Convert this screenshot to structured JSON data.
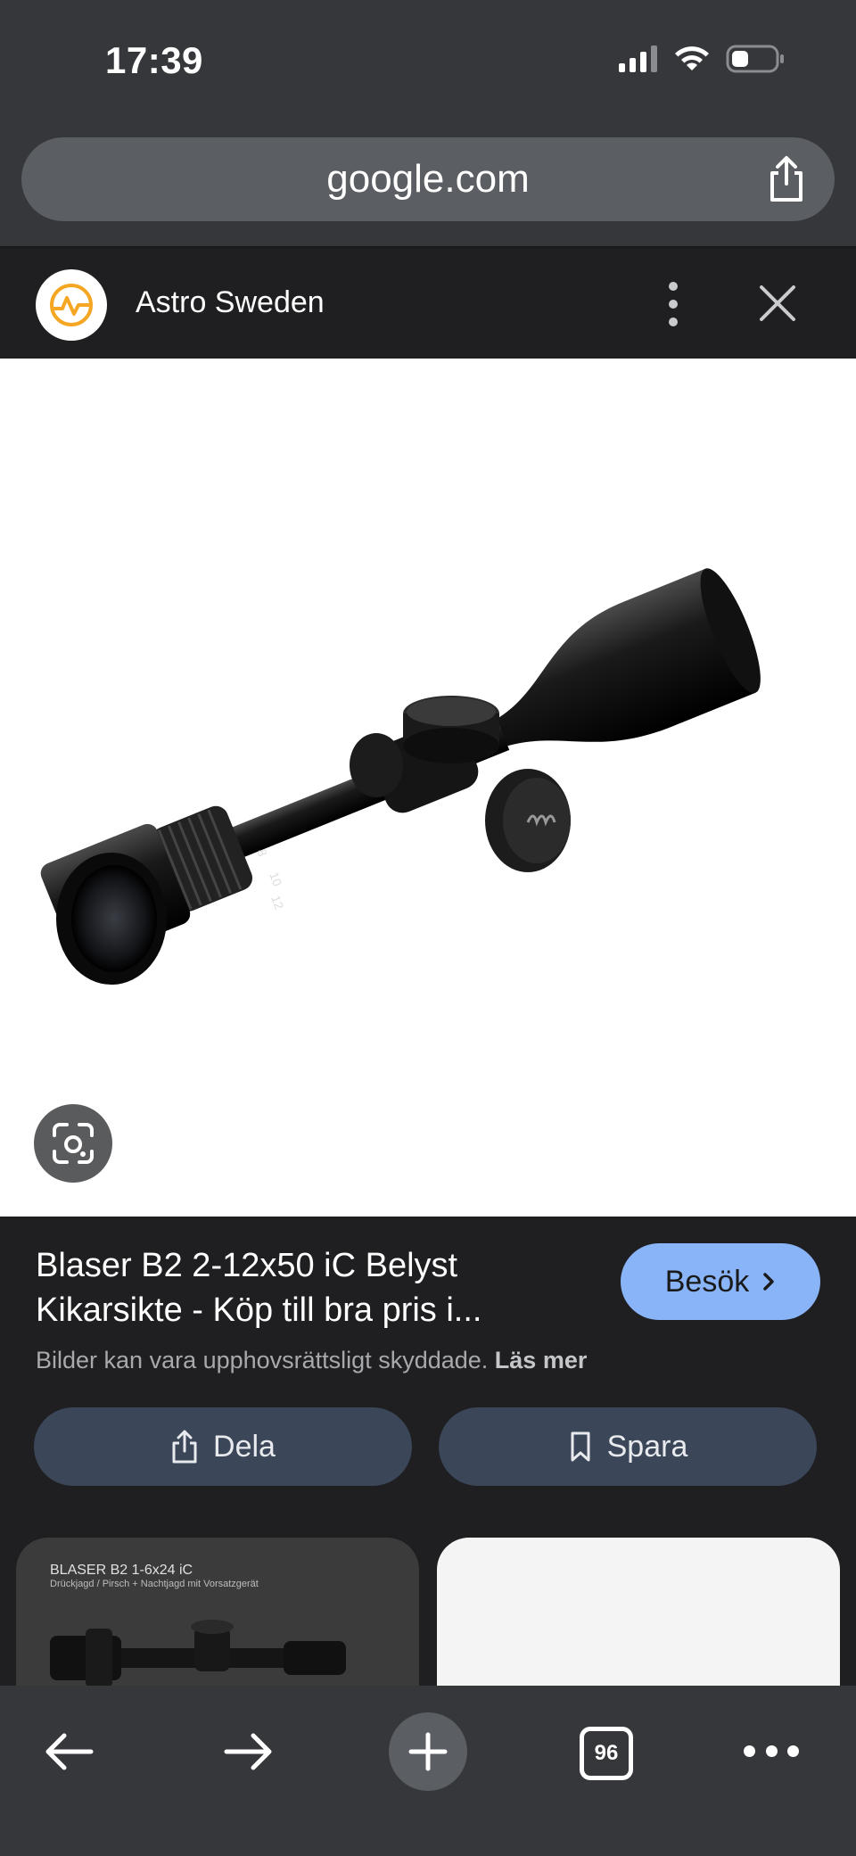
{
  "status": {
    "time": "17:39"
  },
  "browser": {
    "url": "google.com"
  },
  "site": {
    "name": "Astro Sweden"
  },
  "result": {
    "title": "Blaser B2 2-12x50 iC Belyst Kikarsikte - Köp till bra pris i...",
    "copyright_text": "Bilder kan vara upphovsrättsligt skyddade.",
    "copyright_link": "Läs mer",
    "visit_label": "Besök",
    "share_label": "Dela",
    "save_label": "Spara"
  },
  "related": {
    "card1_title": "BLASER B2 1-6x24 iC",
    "card1_sub": "Drückjagd / Pirsch + Nachtjagd mit Vorsatzgerät"
  },
  "toolbar": {
    "tab_count": "96"
  },
  "colors": {
    "accent": "#8ab4f8",
    "button_bg": "#3b4659",
    "chrome": "#35373b",
    "logo": "#f5a623"
  },
  "icons": [
    "signal-icon",
    "wifi-icon",
    "battery-icon",
    "share-icon",
    "more-vert-icon",
    "close-icon",
    "google-lens-icon",
    "chevron-right-icon",
    "bookmark-icon",
    "back-arrow-icon",
    "forward-arrow-icon",
    "plus-icon",
    "tabs-icon",
    "more-horiz-icon"
  ]
}
